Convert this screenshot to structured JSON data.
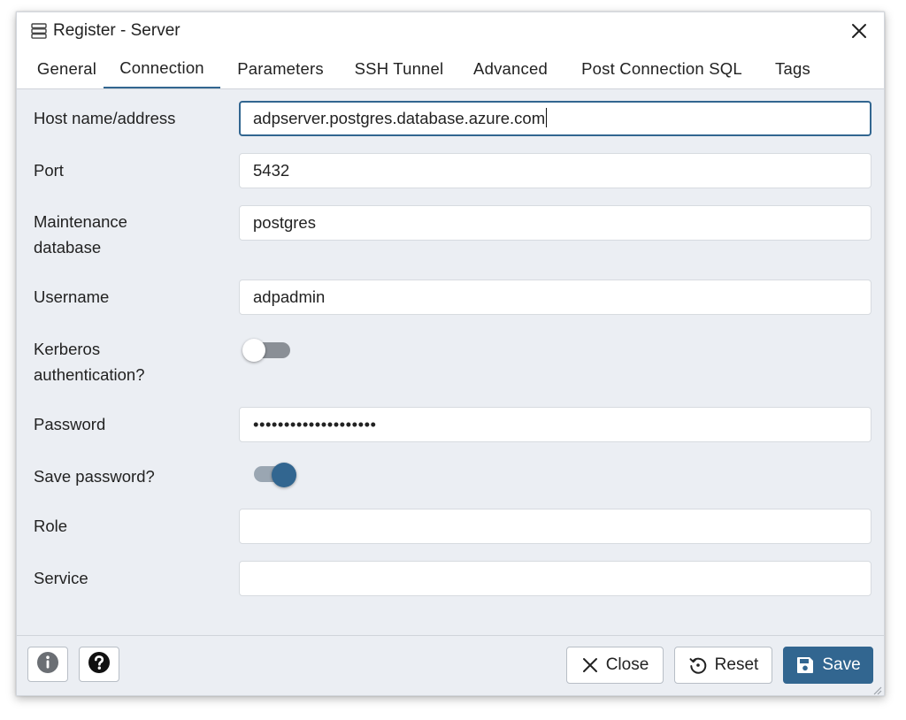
{
  "dialog": {
    "title": "Register - Server",
    "icon": "server-icon",
    "close_icon": "close-icon"
  },
  "tabs": [
    {
      "label": "General",
      "active": false
    },
    {
      "label": "Connection",
      "active": true
    },
    {
      "label": "Parameters",
      "active": false
    },
    {
      "label": "SSH Tunnel",
      "active": false
    },
    {
      "label": "Advanced",
      "active": false
    },
    {
      "label": "Post Connection SQL",
      "active": false
    },
    {
      "label": "Tags",
      "active": false
    }
  ],
  "fields": {
    "host": {
      "label": "Host name/address",
      "value": "adpserver.postgres.database.azure.com"
    },
    "port": {
      "label": "Port",
      "value": "5432"
    },
    "maintenance_db": {
      "label_line1": "Maintenance",
      "label_line2": "database",
      "value": "postgres"
    },
    "username": {
      "label": "Username",
      "value": "adpadmin"
    },
    "kerberos": {
      "label_line1": "Kerberos",
      "label_line2": "authentication?",
      "on": false
    },
    "password": {
      "label": "Password",
      "value": "••••••••••••••••••••"
    },
    "save_password": {
      "label": "Save password?",
      "on": true
    },
    "role": {
      "label": "Role",
      "value": ""
    },
    "service": {
      "label": "Service",
      "value": ""
    }
  },
  "footer": {
    "info_icon": "info-icon",
    "help_icon": "help-icon",
    "close_label": "Close",
    "reset_label": "Reset",
    "save_label": "Save"
  },
  "colors": {
    "accent": "#326690",
    "panel": "#ebeef3",
    "toggle_off_track": "#8a8f96",
    "toggle_on_track": "#9aa6b2"
  }
}
